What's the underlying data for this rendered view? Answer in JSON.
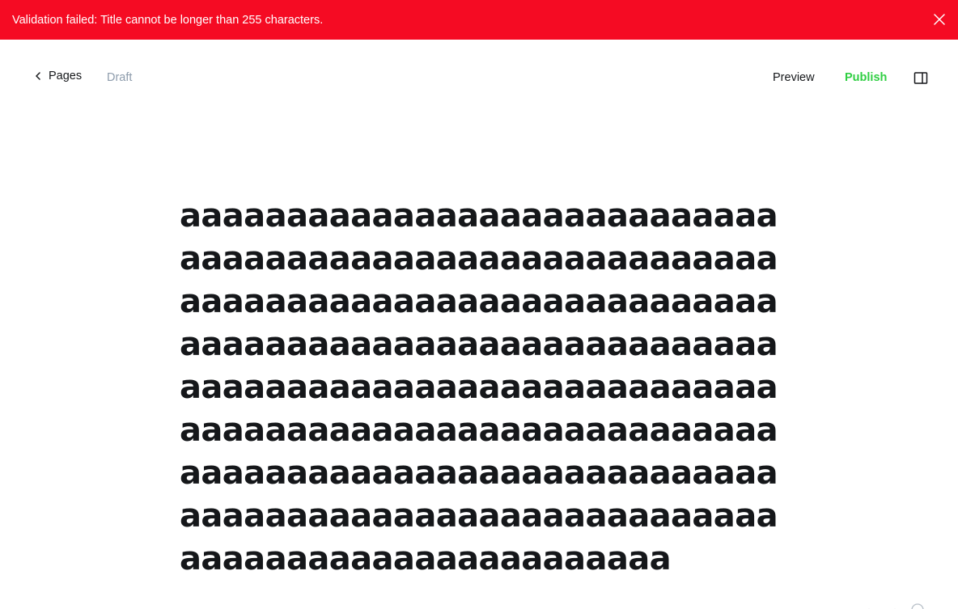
{
  "banner": {
    "message": "Validation failed: Title cannot be longer than 255 characters.",
    "background": "#f50b23"
  },
  "header": {
    "back_label": "Pages",
    "status": "Draft",
    "preview_label": "Preview",
    "publish_label": "Publish",
    "publish_color": "#30cf43"
  },
  "editor": {
    "title": "aaaaaaaaaaaaaaaaaaaaaaaaaaaaaaaaaaaaaaaaaaaaaaaaaaaaaaaaaaaaaaaaaaaaaaaaaaaaaaaaaaaaaaaaaaaaaaaaaaaaaaaaaaaaaaaaaaaaaaaaaaaaaaaaaaaaaaaaaaaaaaaaaaaaaaaaaaaaaaaaaaaaaaaaaaaaaaaaaaaaaaaaaaaaaaaaaaaaaaaaaaaaaaaaaaaaaaaaaaaaaaaaaaaaaaaaaaaaaaaaaaaaaaa"
  }
}
